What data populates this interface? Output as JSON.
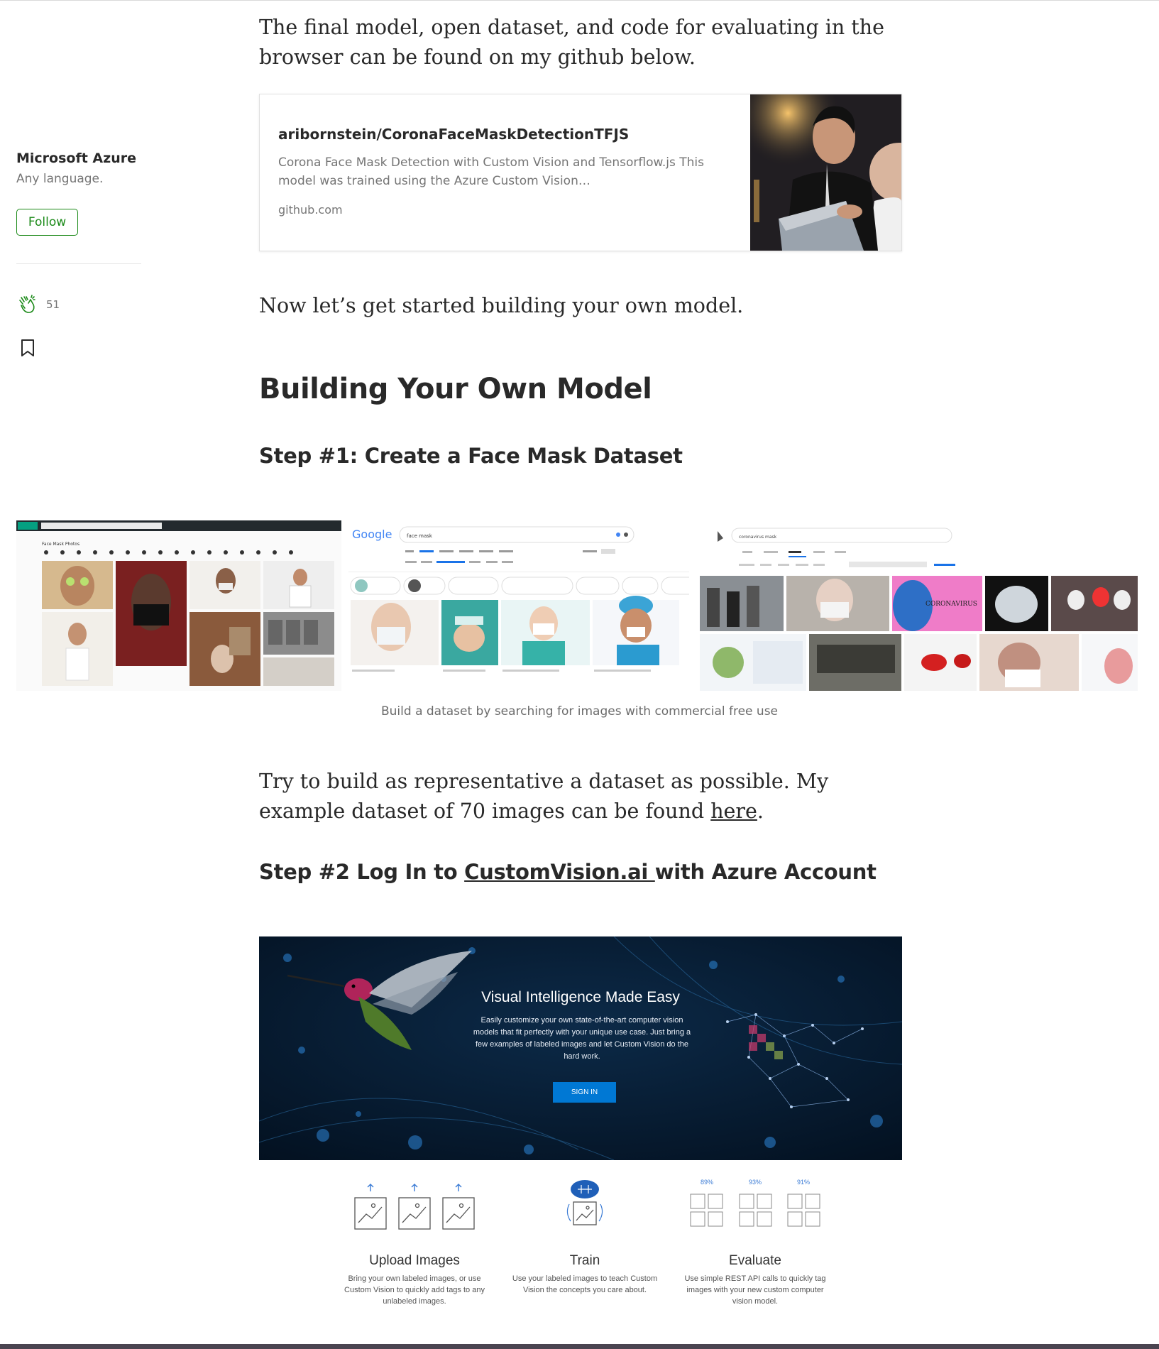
{
  "sidebar": {
    "author_name": "Microsoft Azure",
    "author_tagline": "Any language.",
    "follow_label": "Follow",
    "clap_count": "51"
  },
  "article": {
    "intro_paragraph": "The final model, open dataset, and code for evaluating in the browser can be found on my github below.",
    "link_card": {
      "title": "aribornstein/CoronaFaceMaskDetectionTFJS",
      "description": "Corona Face Mask Detection with Custom Vision and Tensorflow.js This model was trained using the Azure Custom Vision…",
      "domain": "github.com"
    },
    "start_paragraph": "Now let’s get started building your own model.",
    "section_heading": "Building Your Own Model",
    "step1_heading": "Step #1: Create a Face Mask Dataset",
    "figure_caption": "Build a dataset by searching for images with commercial free use",
    "dataset_paragraph_before": "Try to build as representative a dataset as possible. My example dataset of 70 images can be found ",
    "dataset_link": "here",
    "dataset_paragraph_after": ".",
    "step2_prefix": "Step #2 Log In to ",
    "step2_link": "CustomVision.ai ",
    "step2_suffix": "with Azure Account"
  },
  "screenshots": {
    "pexels_heading": "Face Mask Photos",
    "google_logo": "Google",
    "google_query": "face mask",
    "bing_query": "coronavirus mask"
  },
  "custom_vision": {
    "hero_title": "Visual Intelligence Made Easy",
    "hero_text": "Easily customize your own state-of-the-art computer vision models that fit perfectly with your unique use case. Just bring a few examples of labeled images and let Custom Vision do the hard work.",
    "sign_in_label": "SIGN IN",
    "features": [
      {
        "title": "Upload Images",
        "desc": "Bring your own labeled images, or use Custom Vision to quickly add tags to any unlabeled images."
      },
      {
        "title": "Train",
        "desc": "Use your labeled images to teach Custom Vision the concepts you care about."
      },
      {
        "title": "Evaluate",
        "desc": "Use simple REST API calls to quickly tag images with your new custom computer vision model."
      }
    ],
    "evaluate_scores": [
      "89%",
      "93%",
      "91%"
    ]
  },
  "colors": {
    "accent_green": "#1a8917",
    "azure_blue": "#0078d4",
    "text": "#292929",
    "muted": "#757575"
  },
  "icons": [
    "clap-icon",
    "bookmark-icon",
    "upload-arrow-icon",
    "brain-icon",
    "image-icon"
  ]
}
